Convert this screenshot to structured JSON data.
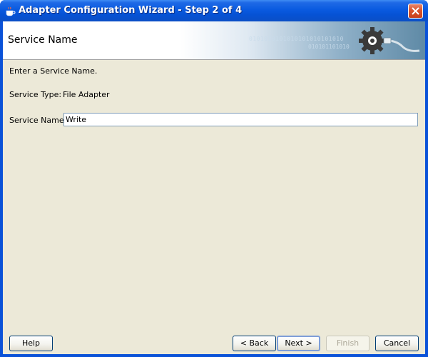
{
  "window": {
    "title": "Adapter Configuration Wizard - Step 2 of 4"
  },
  "banner": {
    "title": "Service Name",
    "binary_line1": "0101010101010101010101010",
    "binary_line2": "010101101010"
  },
  "form": {
    "instruction": "Enter a Service Name.",
    "service_type_label": "Service Type:",
    "service_type_value": "File Adapter",
    "service_name_label": "Service Name:",
    "service_name_value": "Write"
  },
  "buttons": {
    "help": "Help",
    "back": "< Back",
    "next": "Next >",
    "finish": "Finish",
    "cancel": "Cancel"
  },
  "colors": {
    "titlebar": "#0a5ae0",
    "dialog_bg": "#ece9d8",
    "close_button": "#d9542c"
  }
}
